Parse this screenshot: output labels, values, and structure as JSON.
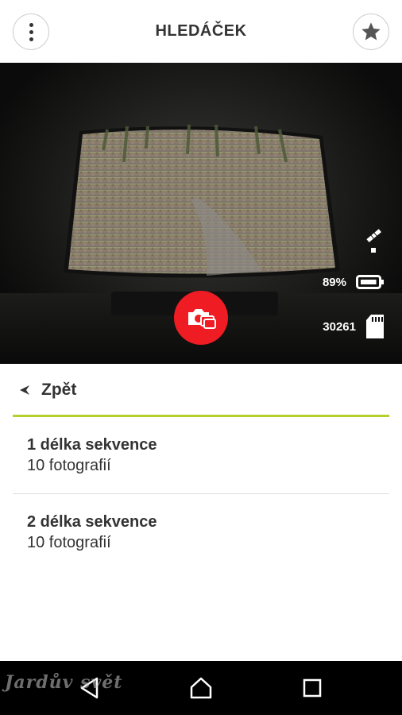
{
  "header": {
    "title": "HLEDÁČEK",
    "menu_icon": "more-vert-icon",
    "favorite_icon": "star-icon"
  },
  "viewfinder": {
    "gps_icon": "satellite-icon",
    "battery_text": "89%",
    "battery_level": 0.89,
    "remaining_photos": "30261",
    "storage_icon": "sd-card-icon",
    "shutter_icon": "burst-camera-icon",
    "shutter_color": "#ef1c24"
  },
  "panel": {
    "back_label": "Zpět",
    "accent_color": "#b7cf2a",
    "items": [
      {
        "title": "1 délka sekvence",
        "subtitle": "10 fotografií"
      },
      {
        "title": "2 délka sekvence",
        "subtitle": "10 fotografií"
      }
    ]
  },
  "navbar": {
    "back_icon": "triangle-back-icon",
    "home_icon": "house-home-icon",
    "recents_icon": "square-recents-icon"
  },
  "watermark": "Jardův svět"
}
